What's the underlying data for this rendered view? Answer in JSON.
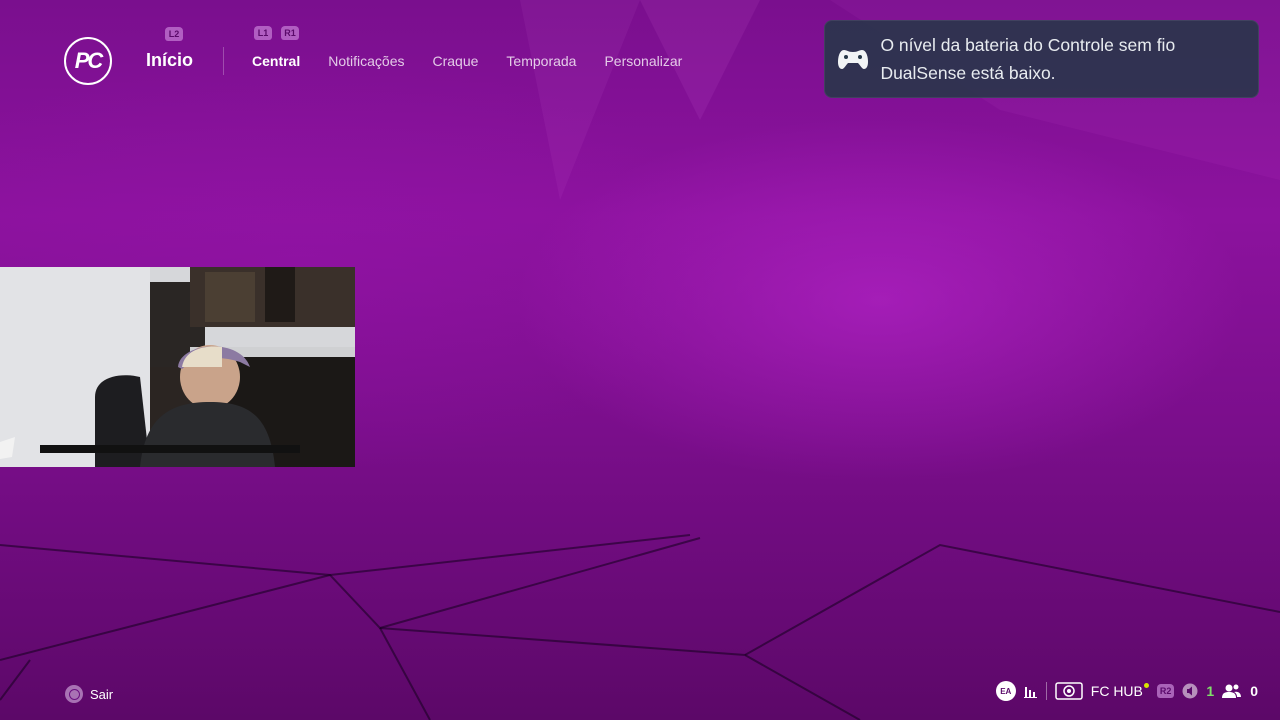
{
  "header": {
    "logo_text": "PC",
    "home_title": "Início",
    "hint_l2": "L2",
    "hint_l1": "L1",
    "hint_r1": "R1",
    "tabs": [
      {
        "label": "Central",
        "active": true
      },
      {
        "label": "Notificações",
        "active": false
      },
      {
        "label": "Craque",
        "active": false
      },
      {
        "label": "Temporada",
        "active": false
      },
      {
        "label": "Personalizar",
        "active": false
      }
    ]
  },
  "notification": {
    "icon": "controller-icon",
    "message": "O nível da bateria do Controle sem fio DualSense está baixo."
  },
  "footer": {
    "exit_label": "Sair",
    "ea_badge": "EA",
    "hub_label": "FC HUB",
    "r2_hint": "R2",
    "green_count": "1",
    "friends_count": "0"
  },
  "colors": {
    "background": "#7a0f8e",
    "notification_bg": "#263748",
    "green_indicator": "#7fe06a",
    "hub_dot": "#d8e400"
  }
}
